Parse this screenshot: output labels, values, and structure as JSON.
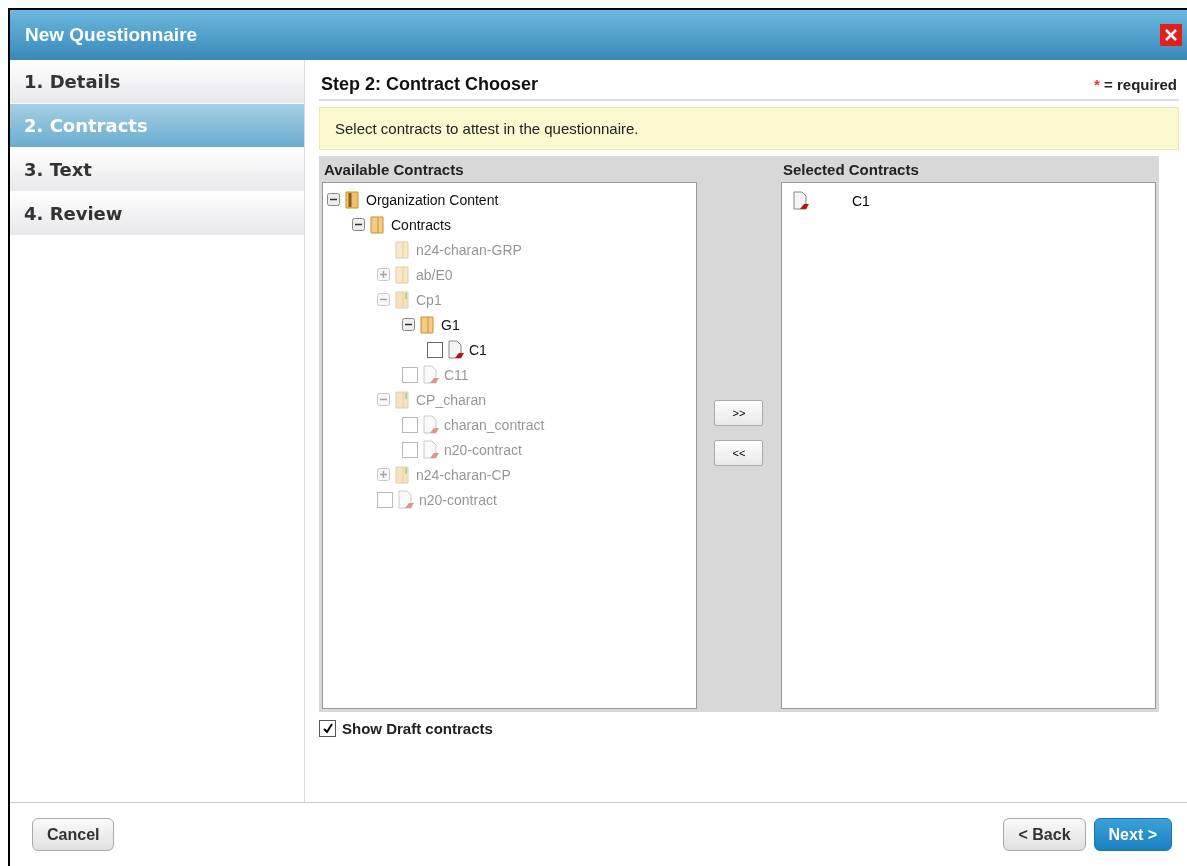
{
  "window": {
    "title": "New Questionnaire"
  },
  "steps": [
    {
      "label": "1. Details",
      "selected": false
    },
    {
      "label": "2. Contracts",
      "selected": true
    },
    {
      "label": "3. Text",
      "selected": false
    },
    {
      "label": "4. Review",
      "selected": false
    }
  ],
  "heading": "Step 2: Contract Chooser",
  "required_note": {
    "mark": "*",
    "text": "= required"
  },
  "hint": "Select contracts to attest in the questionnaire.",
  "available": {
    "title": "Available Contracts",
    "tree": [
      {
        "label": "Organization Content",
        "kind": "root",
        "expanded": true,
        "blurred": false,
        "children": [
          {
            "label": "Contracts",
            "kind": "folder",
            "expanded": true,
            "blurred": false,
            "children": [
              {
                "label": "n24-charan-GRP",
                "kind": "folder",
                "blurred": true
              },
              {
                "label": "ab/E0",
                "kind": "folder",
                "expanded": false,
                "blurred": true
              },
              {
                "label": "Cp1",
                "kind": "cp-folder",
                "expanded": true,
                "blurred": true,
                "children": [
                  {
                    "label": "G1",
                    "kind": "folder",
                    "expanded": true,
                    "blurred": false,
                    "children": [
                      {
                        "label": "C1",
                        "kind": "contract",
                        "checked": false,
                        "blurred": false
                      }
                    ]
                  },
                  {
                    "label": "C11",
                    "kind": "contract",
                    "checked": false,
                    "blurred": true
                  }
                ]
              },
              {
                "label": "CP_charan",
                "kind": "cp-folder",
                "expanded": true,
                "blurred": true,
                "children": [
                  {
                    "label": "charan_contract",
                    "kind": "contract",
                    "checked": false,
                    "blurred": true
                  },
                  {
                    "label": "n20-contract",
                    "kind": "contract",
                    "checked": false,
                    "blurred": true
                  }
                ]
              },
              {
                "label": "n24-charan-CP",
                "kind": "cp-folder",
                "expanded": false,
                "blurred": true
              },
              {
                "label": "n20-contract",
                "kind": "contract",
                "checked": false,
                "blurred": true
              }
            ]
          }
        ]
      }
    ]
  },
  "move_buttons": [
    ">>",
    "<<"
  ],
  "selected": {
    "title": "Selected Contracts",
    "items": [
      {
        "label": "C1"
      }
    ]
  },
  "show_draft": {
    "label": "Show Draft contracts",
    "checked": true
  },
  "footer": {
    "cancel": "Cancel",
    "back": "< Back",
    "next": "Next >"
  }
}
